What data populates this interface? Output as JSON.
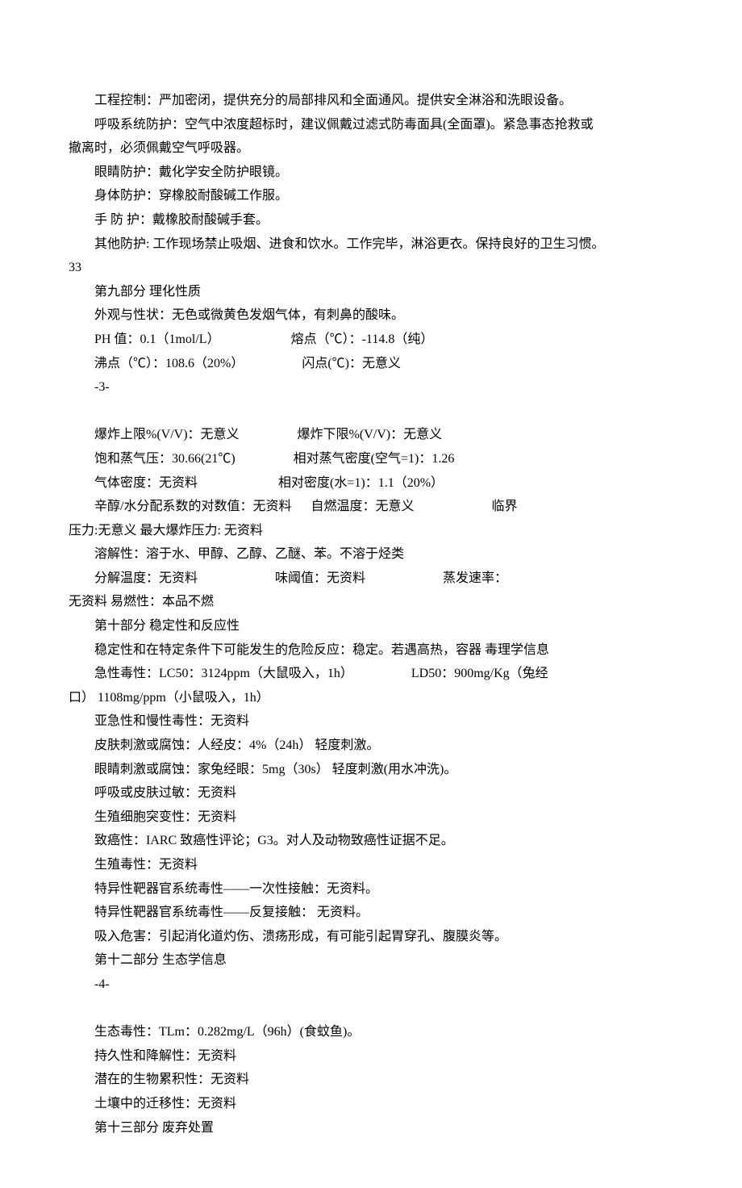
{
  "p1": "工程控制：严加密闭，提供充分的局部排风和全面通风。提供安全淋浴和洗眼设备。",
  "p2a": "呼吸系统防护：空气中浓度超标时，建议佩戴过滤式防毒面具(全面罩)。紧急事态抢救或",
  "p2b": "撤离时，必须佩戴空气呼吸器。",
  "p3": "眼睛防护：戴化学安全防护眼镜。",
  "p4": "身体防护：穿橡胶耐酸碱工作服。",
  "p5": "手 防 护：戴橡胶耐酸碱手套。",
  "p6a": "其他防护: 工作现场禁止吸烟、进食和饮水。工作完毕，淋浴更衣。保持良好的卫生习惯。",
  "p6b": "33",
  "s9": "第九部分      理化性质",
  "p7": "外观与性状：无色或微黄色发烟气体，有刺鼻的酸味。",
  "p8a": "PH 值：0.1（1mol/L）",
  "p8b": "熔点（℃）：-114.8（纯）",
  "p9a": "沸点（℃）：108.6（20%）",
  "p9b": "闪点(℃)：无意义",
  "pg3": "-3-",
  "p10a": "爆炸上限%(V/V)：无意义",
  "p10b": "爆炸下限%(V/V)：无意义",
  "p11a": "饱和蒸气压：30.66(21℃)",
  "p11b": "相对蒸气密度(空气=1)：1.26",
  "p12a": "气体密度：无资料",
  "p12b": "相对密度(水=1)：1.1（20%）",
  "p13a": "辛醇/水分配系数的对数值：无资料",
  "p13b": "自燃温度：无意义",
  "p13c": "临界",
  "p14a": "压力:无意义",
  "p14b": "最大爆炸压力: 无资料",
  "p15": "溶解性：溶于水、甲醇、乙醇、乙醚、苯。不溶于烃类",
  "p16a": "分解温度：无资料",
  "p16b": "味阈值：无资料",
  "p16c": "蒸发速率：",
  "p17a": "无资料",
  "p17b": "易燃性：本品不燃",
  "s10": "第十部分      稳定性和反应性",
  "p18": "稳定性和在特定条件下可能发生的危险反应：稳定。若遇高热，容器   毒理学信息",
  "p19a": "急性毒性：LC50：3124ppm（大鼠吸入，1h）",
  "p19b": "LD50：900mg/Kg（兔经",
  "p20a": "口）",
  "p20b": "1108mg/ppm（小鼠吸入，1h）",
  "p21": "亚急性和慢性毒性：无资料",
  "p22": "皮肤刺激或腐蚀：人经皮：4%（24h）  轻度刺激。",
  "p23": "眼睛刺激或腐蚀：家兔经眼：5mg（30s）  轻度刺激(用水冲洗)。",
  "p24": "呼吸或皮肤过敏：无资料",
  "p25": "生殖细胞突变性：无资料",
  "p26": "致癌性：IARC 致癌性评论；G3。对人及动物致癌性证据不足。",
  "p27": "生殖毒性：无资料",
  "p28": "特异性靶器官系统毒性——一次性接触：无资料。",
  "p29": "特异性靶器官系统毒性——反复接触：  无资料。",
  "p30": "吸入危害：引起消化道灼伤、溃疡形成，有可能引起胃穿孔、腹膜炎等。",
  "s12": "第十二部分      生态学信息",
  "pg4": "-4-",
  "p31": "生态毒性：TLm：0.282mg/L（96h）(食蚊鱼)。",
  "p32": "持久性和降解性：无资料",
  "p33": "潜在的生物累积性：无资料",
  "p34": "土壤中的迁移性：无资料",
  "s13": "第十三部分      废弃处置"
}
